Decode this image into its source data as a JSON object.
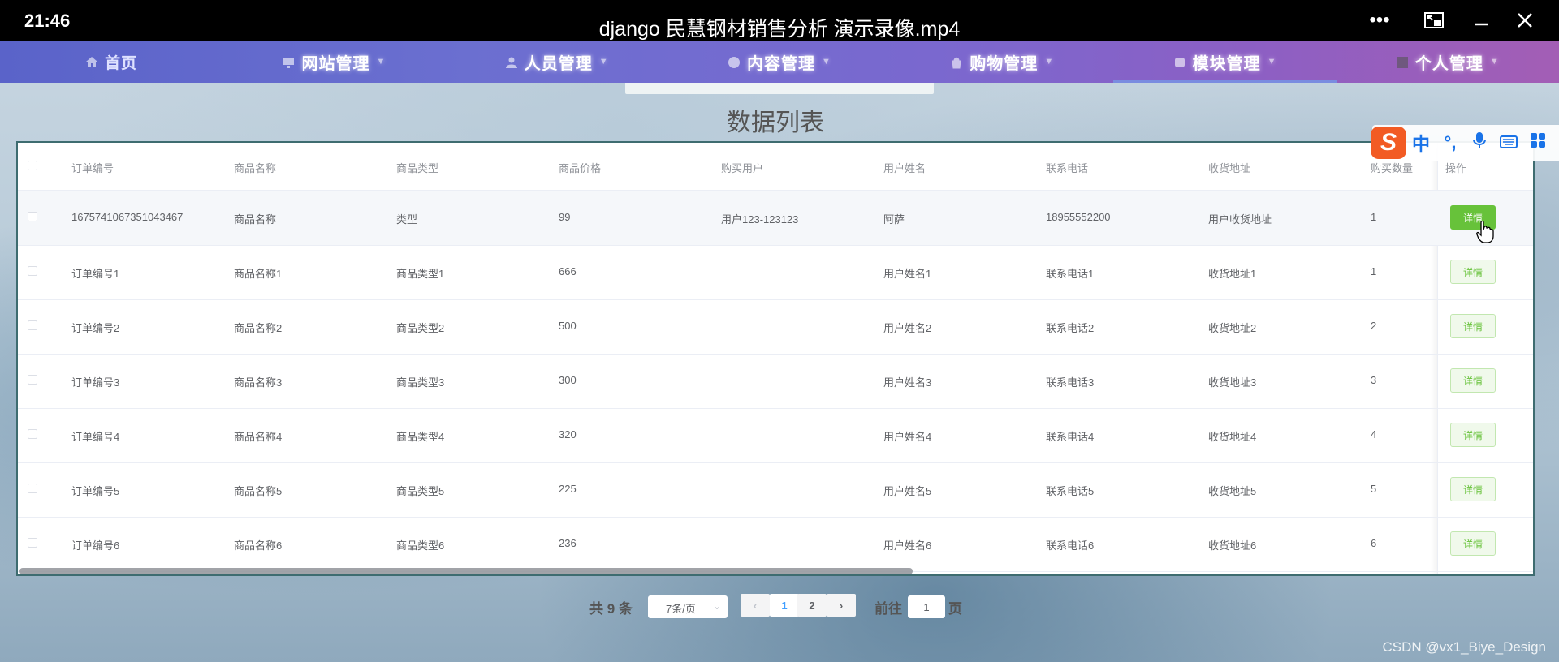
{
  "titlebar": {
    "time": "21:46",
    "title": "django 民慧钢材销售分析 演示录像.mp4",
    "buttons": [
      "more-icon",
      "pip-icon",
      "minimize-icon",
      "close-icon"
    ]
  },
  "nav": {
    "items": [
      {
        "label": "首页",
        "icon": "home-icon"
      },
      {
        "label": "网站管理",
        "icon": "monitor-icon"
      },
      {
        "label": "人员管理",
        "icon": "user-icon"
      },
      {
        "label": "内容管理",
        "icon": "chat-icon"
      },
      {
        "label": "购物管理",
        "icon": "bag-icon"
      },
      {
        "label": "模块管理",
        "icon": "module-icon"
      },
      {
        "label": "个人管理",
        "icon": "person-card-icon"
      }
    ]
  },
  "list_title": "数据列表",
  "table": {
    "headers": [
      "订单编号",
      "商品名称",
      "商品类型",
      "商品价格",
      "购买用户",
      "用户姓名",
      "联系电话",
      "收货地址",
      "购买数量",
      "操作"
    ],
    "action_label": "详情",
    "rows": [
      {
        "order_no": "1675741067351043467",
        "name": "商品名称",
        "type": "类型",
        "price": "99",
        "buyer": "用户123-123123",
        "user_name": "阿萨",
        "phone": "18955552200",
        "address": "用户收货地址",
        "qty": "1"
      },
      {
        "order_no": "订单编号1",
        "name": "商品名称1",
        "type": "商品类型1",
        "price": "666",
        "buyer": "",
        "user_name": "用户姓名1",
        "phone": "联系电话1",
        "address": "收货地址1",
        "qty": "1"
      },
      {
        "order_no": "订单编号2",
        "name": "商品名称2",
        "type": "商品类型2",
        "price": "500",
        "buyer": "",
        "user_name": "用户姓名2",
        "phone": "联系电话2",
        "address": "收货地址2",
        "qty": "2"
      },
      {
        "order_no": "订单编号3",
        "name": "商品名称3",
        "type": "商品类型3",
        "price": "300",
        "buyer": "",
        "user_name": "用户姓名3",
        "phone": "联系电话3",
        "address": "收货地址3",
        "qty": "3"
      },
      {
        "order_no": "订单编号4",
        "name": "商品名称4",
        "type": "商品类型4",
        "price": "320",
        "buyer": "",
        "user_name": "用户姓名4",
        "phone": "联系电话4",
        "address": "收货地址4",
        "qty": "4"
      },
      {
        "order_no": "订单编号5",
        "name": "商品名称5",
        "type": "商品类型5",
        "price": "225",
        "buyer": "",
        "user_name": "用户姓名5",
        "phone": "联系电话5",
        "address": "收货地址5",
        "qty": "5"
      },
      {
        "order_no": "订单编号6",
        "name": "商品名称6",
        "type": "商品类型6",
        "price": "236",
        "buyer": "",
        "user_name": "用户姓名6",
        "phone": "联系电话6",
        "address": "收货地址6",
        "qty": "6"
      }
    ]
  },
  "ime": {
    "logo": "S",
    "items": [
      "中",
      "°,",
      "mic-icon",
      "keyboard-icon",
      "grid-icon"
    ]
  },
  "pagination": {
    "total": "共 9 条",
    "page_size": "7条/页",
    "pages": [
      "1",
      "2"
    ],
    "current": "1",
    "goto_label": "前往",
    "goto_value": "1",
    "goto_unit": "页"
  },
  "watermark": "CSDN @vx1_Biye_Design",
  "colors": {
    "nav_start": "#5a63c9",
    "nav_end": "#a35eb5",
    "detail_button": "#67c23a",
    "table_border": "#3e6c70",
    "ime_logo": "#f25b24"
  }
}
